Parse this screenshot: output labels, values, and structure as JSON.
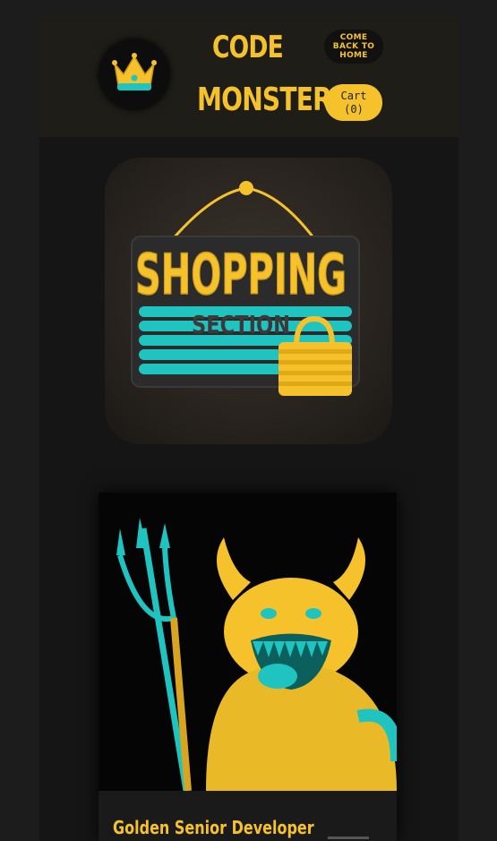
{
  "header": {
    "brand_line1": "CODE",
    "brand_line2": "MONSTER",
    "home_button": "COME BACK TO HOME",
    "cart_label": "Cart",
    "cart_count": "(0)"
  },
  "hero": {
    "sign_title": "SHOPPING",
    "sign_subtitle": "SECTION"
  },
  "product": {
    "title": "Golden Senior Developer"
  },
  "colors": {
    "accent": "#f6c22b",
    "teal": "#1fc4c0",
    "background": "#1c1c1c"
  }
}
